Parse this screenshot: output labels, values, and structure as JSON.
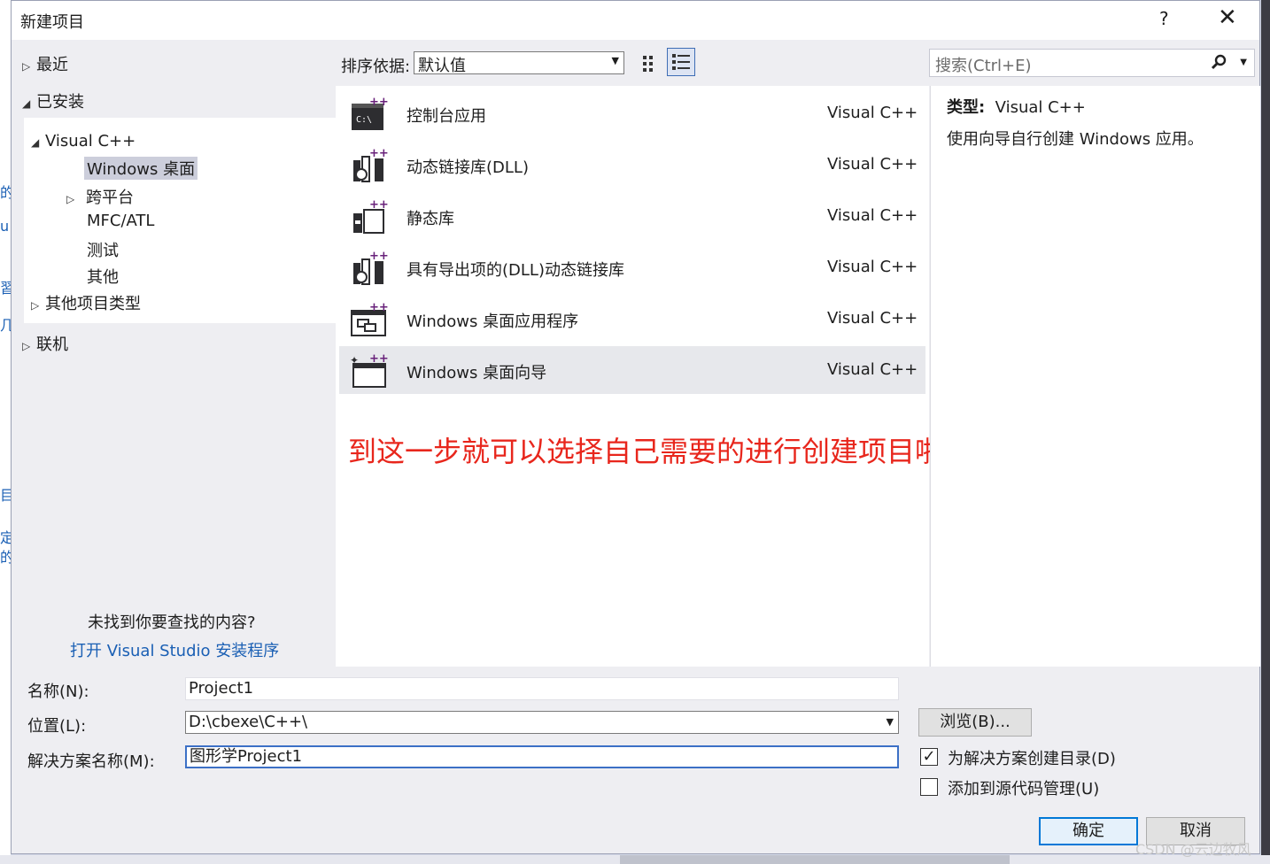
{
  "window": {
    "title": "新建项目",
    "help_glyph": "?",
    "close_glyph": "✕"
  },
  "nav": {
    "recent": "最近",
    "installed": "已安装",
    "tree": {
      "visual_cpp": "Visual C++",
      "windows_desktop": "Windows 桌面",
      "cross_platform": "跨平台",
      "mfc_atl": "MFC/ATL",
      "test": "测试",
      "other": "其他",
      "other_project_types": "其他项目类型"
    },
    "online": "联机",
    "not_found": "未找到你要查找的内容?",
    "open_installer": "打开 Visual Studio 安装程序"
  },
  "toolbar": {
    "sort_label": "排序依据:",
    "sort_value": "默认值",
    "search_placeholder": "搜索(Ctrl+E)",
    "icons": [
      "grid-view-icon",
      "list-view-icon",
      "search-icon",
      "chevron-down-icon"
    ]
  },
  "templates": [
    {
      "name": "控制台应用",
      "language": "Visual C++",
      "icon": "console-app-icon"
    },
    {
      "name": "动态链接库(DLL)",
      "language": "Visual C++",
      "icon": "dll-icon"
    },
    {
      "name": "静态库",
      "language": "Visual C++",
      "icon": "static-lib-icon"
    },
    {
      "name": "具有导出项的(DLL)动态链接库",
      "language": "Visual C++",
      "icon": "dll-exports-icon"
    },
    {
      "name": "Windows 桌面应用程序",
      "language": "Visual C++",
      "icon": "desktop-app-icon"
    },
    {
      "name": "Windows 桌面向导",
      "language": "Visual C++",
      "icon": "desktop-wizard-icon",
      "selected": true
    }
  ],
  "annotation": "到这一步就可以选择自己需要的进行创建项目啦！！！",
  "details": {
    "type_label": "类型:",
    "type_value": "Visual C++",
    "description": "使用向导自行创建 Windows 应用。"
  },
  "form": {
    "name_label": "名称(N):",
    "name_value": "Project1",
    "location_label": "位置(L):",
    "location_value": "D:\\cbexe\\C++\\",
    "solution_label": "解决方案名称(M):",
    "solution_value": "图形学Project1",
    "browse_label": "浏览(B)...",
    "create_dir_label": "为解决方案创建目录(D)",
    "create_dir_checked": true,
    "source_control_label": "添加到源代码管理(U)",
    "source_control_checked": false,
    "ok_label": "确定",
    "cancel_label": "取消"
  },
  "background": {
    "left_fragments": [
      "的",
      "u",
      "習",
      "几",
      "目",
      "定",
      "的"
    ]
  },
  "watermark": "CSDN @云边牧风",
  "colors": {
    "accent": "#0078d7",
    "link": "#1a5fb4",
    "annotation": "#e8261c",
    "icon_purple": "#68217a"
  }
}
